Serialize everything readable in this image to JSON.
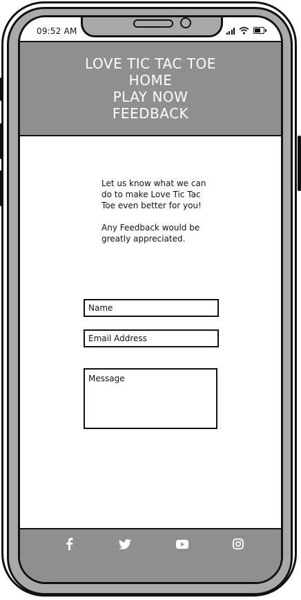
{
  "status_bar": {
    "time": "09:52 AM",
    "battery_level": 0.7,
    "icons": [
      "signal-icon",
      "wifi-icon",
      "battery-icon"
    ]
  },
  "header": {
    "title": "LOVE TIC TAC TOE",
    "nav": [
      {
        "label": "HOME"
      },
      {
        "label": "PLAY NOW"
      },
      {
        "label": "FEEDBACK"
      }
    ],
    "background": "#8f8f8f",
    "text_color": "#ffffff"
  },
  "main": {
    "intro_line_1": "Let us know what we can do to make Love Tic Tac Toe even better for you!",
    "intro_line_2": "Any Feedback would be greatly appreciated."
  },
  "form": {
    "name_placeholder": "Name",
    "email_placeholder": "Email Address",
    "message_placeholder": "Message"
  },
  "footer": {
    "social_icons": [
      "facebook-icon",
      "twitter-icon",
      "youtube-icon",
      "instagram-icon"
    ],
    "background": "#8f8f8f"
  }
}
